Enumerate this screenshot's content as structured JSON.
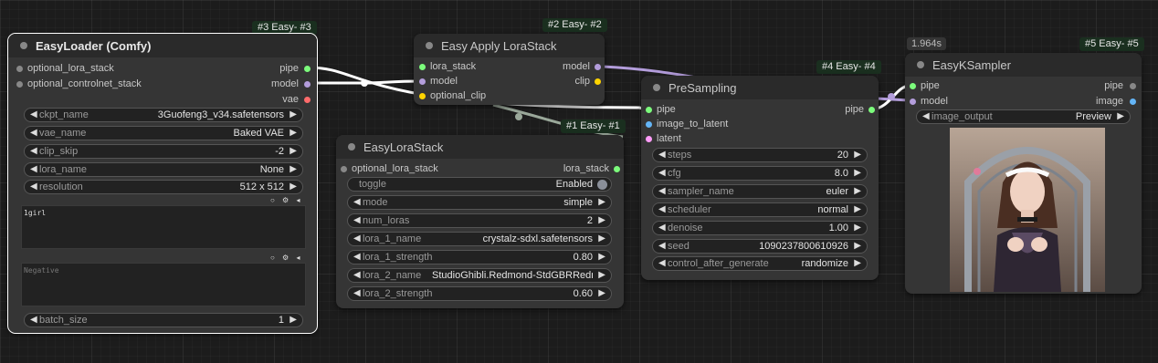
{
  "colors": {
    "pipe": "#7cfc7c",
    "model": "#b39ddb",
    "clip": "#ffd400",
    "vae": "#ff6b6b",
    "image": "#64b5f6",
    "latent": "#ff9cf9",
    "lora_stack": "#7cfc7c",
    "neutral": "#888888"
  },
  "loader": {
    "badge": "#3 Easy- #3",
    "title": "EasyLoader (Comfy)",
    "inputs": [
      "optional_lora_stack",
      "optional_controlnet_stack"
    ],
    "outputs": [
      "pipe",
      "model",
      "vae"
    ],
    "widgets": [
      {
        "label": "ckpt_name",
        "value": "3Guofeng3_v34.safetensors"
      },
      {
        "label": "vae_name",
        "value": "Baked VAE"
      },
      {
        "label": "clip_skip",
        "value": "-2"
      },
      {
        "label": "lora_name",
        "value": "None"
      },
      {
        "label": "resolution",
        "value": "512 x 512"
      }
    ],
    "positive_text": "1girl",
    "negative_placeholder": "Negative",
    "batch": {
      "label": "batch_size",
      "value": "1"
    }
  },
  "apply": {
    "badge": "#2 Easy- #2",
    "title": "Easy Apply LoraStack",
    "inputs": [
      "lora_stack",
      "model",
      "optional_clip"
    ],
    "outputs": [
      "model",
      "clip"
    ]
  },
  "lorastack": {
    "badge": "#1 Easy- #1",
    "title": "EasyLoraStack",
    "input": "optional_lora_stack",
    "output": "lora_stack",
    "toggle": {
      "label": "toggle",
      "value": "Enabled"
    },
    "widgets": [
      {
        "label": "mode",
        "value": "simple"
      },
      {
        "label": "num_loras",
        "value": "2"
      },
      {
        "label": "lora_1_name",
        "value": "crystalz-sdxl.safetensors"
      },
      {
        "label": "lora_1_strength",
        "value": "0.80"
      },
      {
        "label": "lora_2_name",
        "value": "StudioGhibli.Redmond-StdGBRRedmA..."
      },
      {
        "label": "lora_2_strength",
        "value": "0.60"
      }
    ]
  },
  "presampling": {
    "badge": "#4 Easy- #4",
    "title": "PreSampling",
    "inputs": [
      "pipe",
      "image_to_latent",
      "latent"
    ],
    "output": "pipe",
    "widgets": [
      {
        "label": "steps",
        "value": "20"
      },
      {
        "label": "cfg",
        "value": "8.0"
      },
      {
        "label": "sampler_name",
        "value": "euler"
      },
      {
        "label": "scheduler",
        "value": "normal"
      },
      {
        "label": "denoise",
        "value": "1.00"
      },
      {
        "label": "seed",
        "value": "1090237800610926"
      },
      {
        "label": "control_after_generate",
        "value": "randomize"
      }
    ]
  },
  "ksampler": {
    "timing": "1.964s",
    "badge": "#5 Easy- #5",
    "title": "EasyKSampler",
    "inputs": [
      "pipe",
      "model"
    ],
    "outputs": [
      "pipe",
      "image"
    ],
    "image_output": {
      "label": "image_output",
      "value": "Preview"
    }
  }
}
